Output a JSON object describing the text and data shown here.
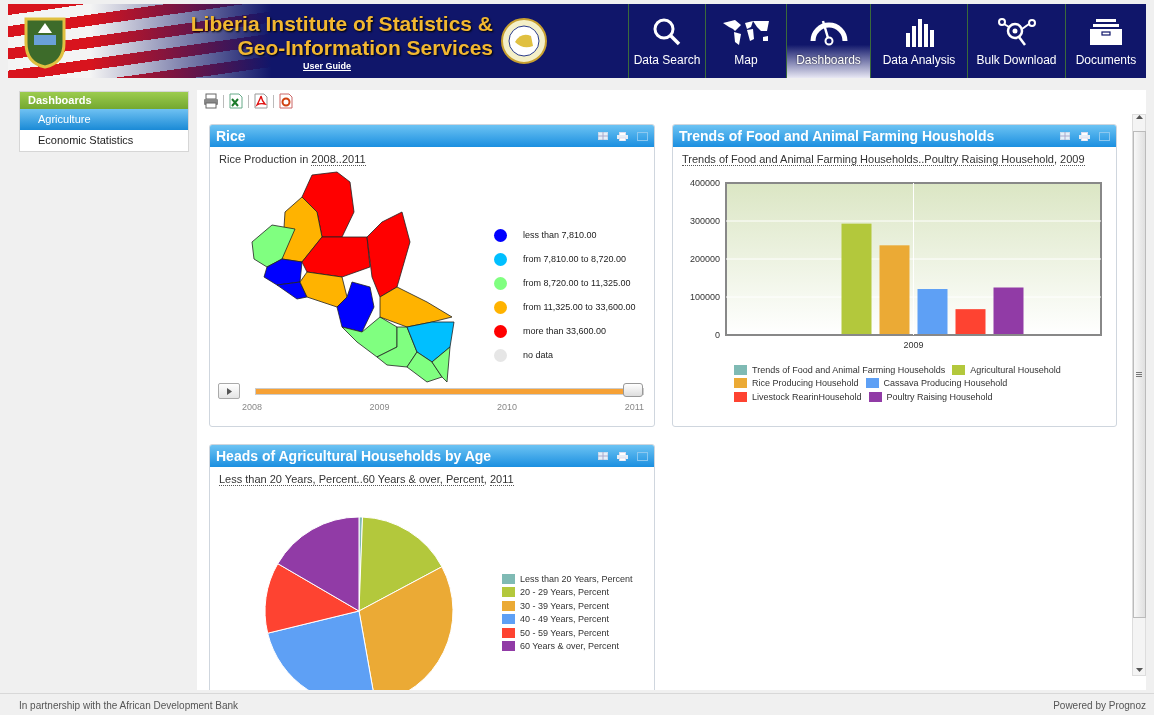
{
  "header": {
    "title_lines": [
      "Liberia Institute of Statistics &",
      "Geo-Information Services"
    ],
    "user_guide": "User Guide"
  },
  "nav": [
    {
      "label": "Data Search",
      "selected": false
    },
    {
      "label": "Map",
      "selected": false
    },
    {
      "label": "Dashboards",
      "selected": true
    },
    {
      "label": "Data Analysis",
      "selected": false
    },
    {
      "label": "Bulk Download",
      "selected": false
    },
    {
      "label": "Documents",
      "selected": false
    }
  ],
  "sidebar": {
    "title": "Dashboards",
    "items": [
      {
        "label": "Agriculture",
        "selected": true
      },
      {
        "label": "Economic Statistics",
        "selected": false
      }
    ]
  },
  "panels": [
    {
      "kind": "map",
      "title": "Rice",
      "subtitle": [
        {
          "text": "Rice Production in ",
          "link": false
        },
        {
          "text": "2008..2011",
          "link": true
        }
      ],
      "legend": [
        {
          "label": "less than 7,810.00",
          "color": "#0000ff"
        },
        {
          "label": "from 7,810.00 to 8,720.00",
          "color": "#00bfff"
        },
        {
          "label": "from 8,720.00 to 11,325.00",
          "color": "#80ff80"
        },
        {
          "label": "from 11,325.00 to 33,600.00",
          "color": "#ffb300"
        },
        {
          "label": "more than 33,600.00",
          "color": "#ff0000"
        },
        {
          "label": "no data",
          "color": "#e6e6e6"
        }
      ],
      "timeline": {
        "level": 1,
        "years": [
          "2008",
          "2009",
          "2010",
          "2011"
        ]
      }
    },
    {
      "kind": "bar",
      "title": "Trends of Food and Animal Farming Housholds",
      "subtitle": [
        {
          "text": "Trends of Food and Animal Farming Households..Poultry Raising Household",
          "link": true
        },
        {
          "text": ", ",
          "link": false
        },
        {
          "text": "2009",
          "link": true
        }
      ],
      "chart_data": {
        "type": "bar",
        "grid": true,
        "categories": [
          "2009"
        ],
        "ylim": [
          0,
          400000
        ],
        "yticks": [
          0,
          100000,
          200000,
          300000,
          400000
        ],
        "series": [
          {
            "name": "Trends of Food and Animal Farming Households",
            "color": "#7fbab4",
            "values": [
              null
            ]
          },
          {
            "name": "Agricultural Household",
            "color": "#b3c83c",
            "values": [
              293000
            ]
          },
          {
            "name": "Rice Producing Household",
            "color": "#ebaa35",
            "values": [
              236000
            ]
          },
          {
            "name": "Cassava Producing Household",
            "color": "#5ea0f5",
            "values": [
              121000
            ]
          },
          {
            "name": "Livestock RearinHousehold",
            "color": "#fe4331",
            "values": [
              68000
            ]
          },
          {
            "name": "Poultry Raising Household",
            "color": "#913ba6",
            "values": [
              125000
            ]
          }
        ]
      }
    },
    {
      "kind": "pie",
      "title": "Heads of Agricultural Households by Age",
      "subtitle": [
        {
          "text": "Less than 20 Years, Percent..60 Years & over, Percent",
          "link": true
        },
        {
          "text": ", ",
          "link": false
        },
        {
          "text": "2011",
          "link": true
        }
      ],
      "legend": [
        {
          "label": "Less than 20 Years, Percent",
          "color": "#7fbab4"
        },
        {
          "label": "20 - 29 Years, Percent",
          "color": "#b3c83c"
        },
        {
          "label": "30 - 39 Years, Percent",
          "color": "#ebaa35"
        },
        {
          "label": "40 - 49 Years, Percent",
          "color": "#5ea0f5"
        },
        {
          "label": "50 - 59 Years, Percent",
          "color": "#fe4331"
        },
        {
          "label": "60 Years & over, Percent",
          "color": "#913ba6"
        }
      ]
    }
  ],
  "footer": {
    "left": "In partnership with the African Development Bank",
    "right": "Powered by Prognoz"
  }
}
